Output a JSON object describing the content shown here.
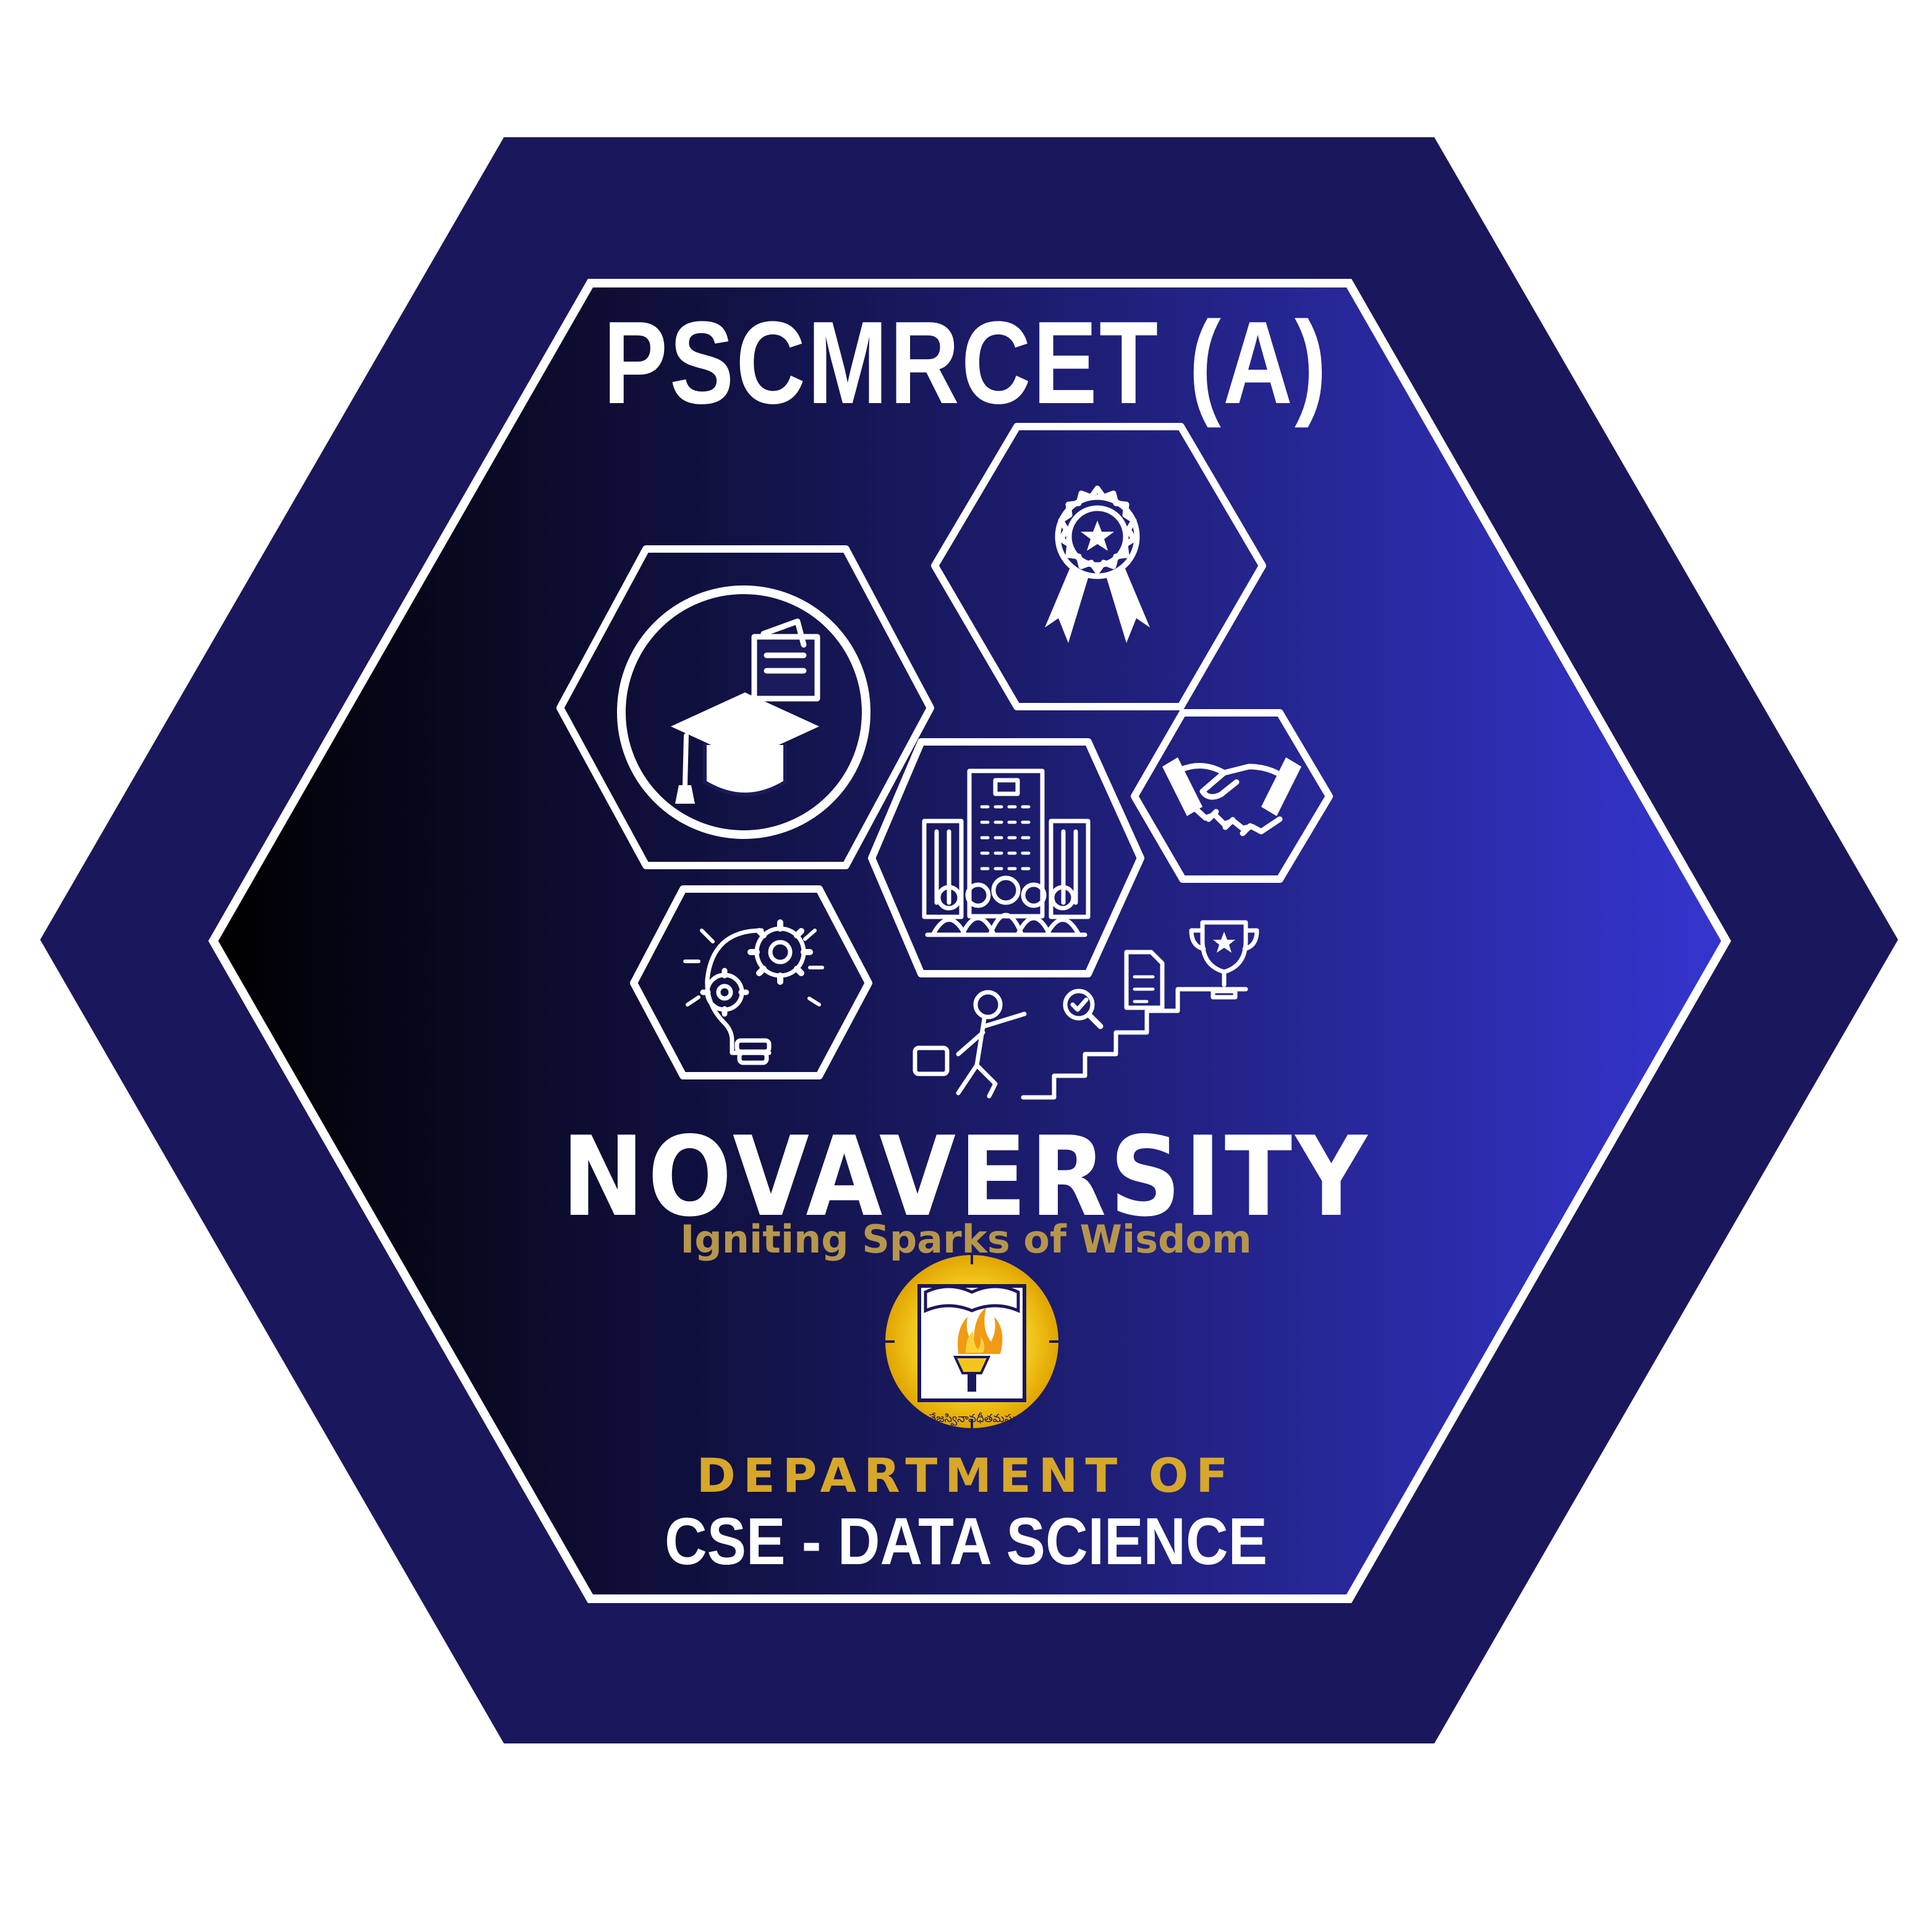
{
  "badge": {
    "college_name": "PSCMRCET (A)",
    "event_name": "NOVAVERSITY",
    "tagline": "Igniting Sparks of Wisdom",
    "department_label": "DEPARTMENT OF",
    "department_name": "CSE - DATA SCIENCE",
    "emblem_motto": "తేజస్వినావధీతమస్తు"
  },
  "icons": [
    "award-ribbon-icon",
    "graduation-cap-icon",
    "campus-building-icon",
    "handshake-icon",
    "idea-gears-icon",
    "career-steps-icon",
    "trophy-icon"
  ],
  "colors": {
    "outer_hexagon": "#1b175c",
    "inner_gradient_start": "#000000",
    "inner_gradient_end": "#3535cf",
    "outline": "#ffffff",
    "tagline": "#b6964c",
    "department_label": "#d6a72a",
    "emblem_gold": "#f2c51c"
  }
}
